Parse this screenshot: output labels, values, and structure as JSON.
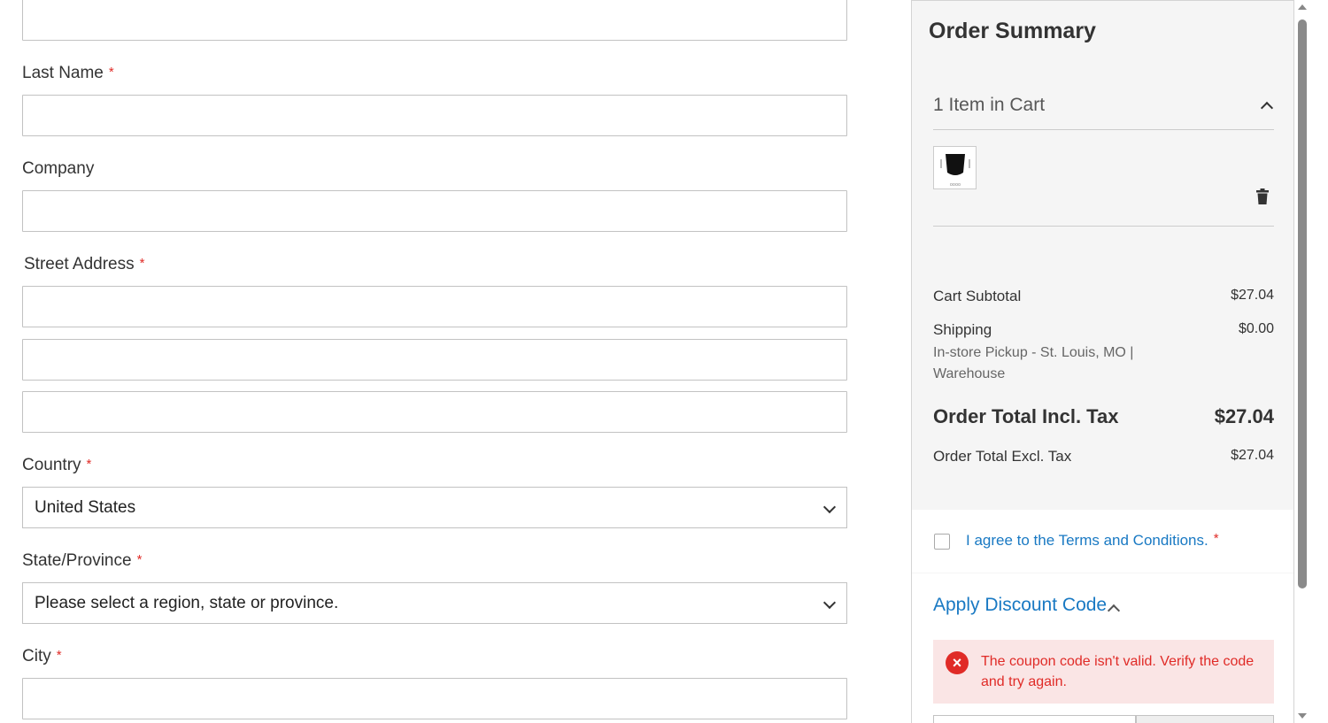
{
  "form": {
    "last_name_label": "Last Name",
    "company_label": "Company",
    "street_label": "Street Address",
    "country_label": "Country",
    "country_value": "United States",
    "state_label": "State/Province",
    "state_value": "Please select a region, state or province.",
    "city_label": "City",
    "required_mark": "*"
  },
  "summary": {
    "title": "Order Summary",
    "items_in_cart": "1 Item in Cart",
    "cart_subtotal_label": "Cart Subtotal",
    "cart_subtotal_value": "$27.04",
    "shipping_label": "Shipping",
    "shipping_value": "$0.00",
    "shipping_method": "In-store Pickup - St. Louis, MO | Warehouse",
    "total_incl_label": "Order Total Incl. Tax",
    "total_incl_value": "$27.04",
    "total_excl_label": "Order Total Excl. Tax",
    "total_excl_value": "$27.04"
  },
  "terms": {
    "text": "I agree to the Terms and Conditions.",
    "required_mark": "*"
  },
  "discount": {
    "title": "Apply Discount Code",
    "error": "The coupon code isn't valid. Verify the code and try again.",
    "error_icon": "×"
  },
  "icons": {
    "trash": "trash-icon",
    "collapse": "chevron-up-icon",
    "dropdown": "chevron-down-icon",
    "error": "error-x-icon"
  },
  "colors": {
    "required": "#e02b27",
    "link": "#1979c3",
    "error_bg": "#fae5e5",
    "summary_bg": "#f5f5f5"
  }
}
